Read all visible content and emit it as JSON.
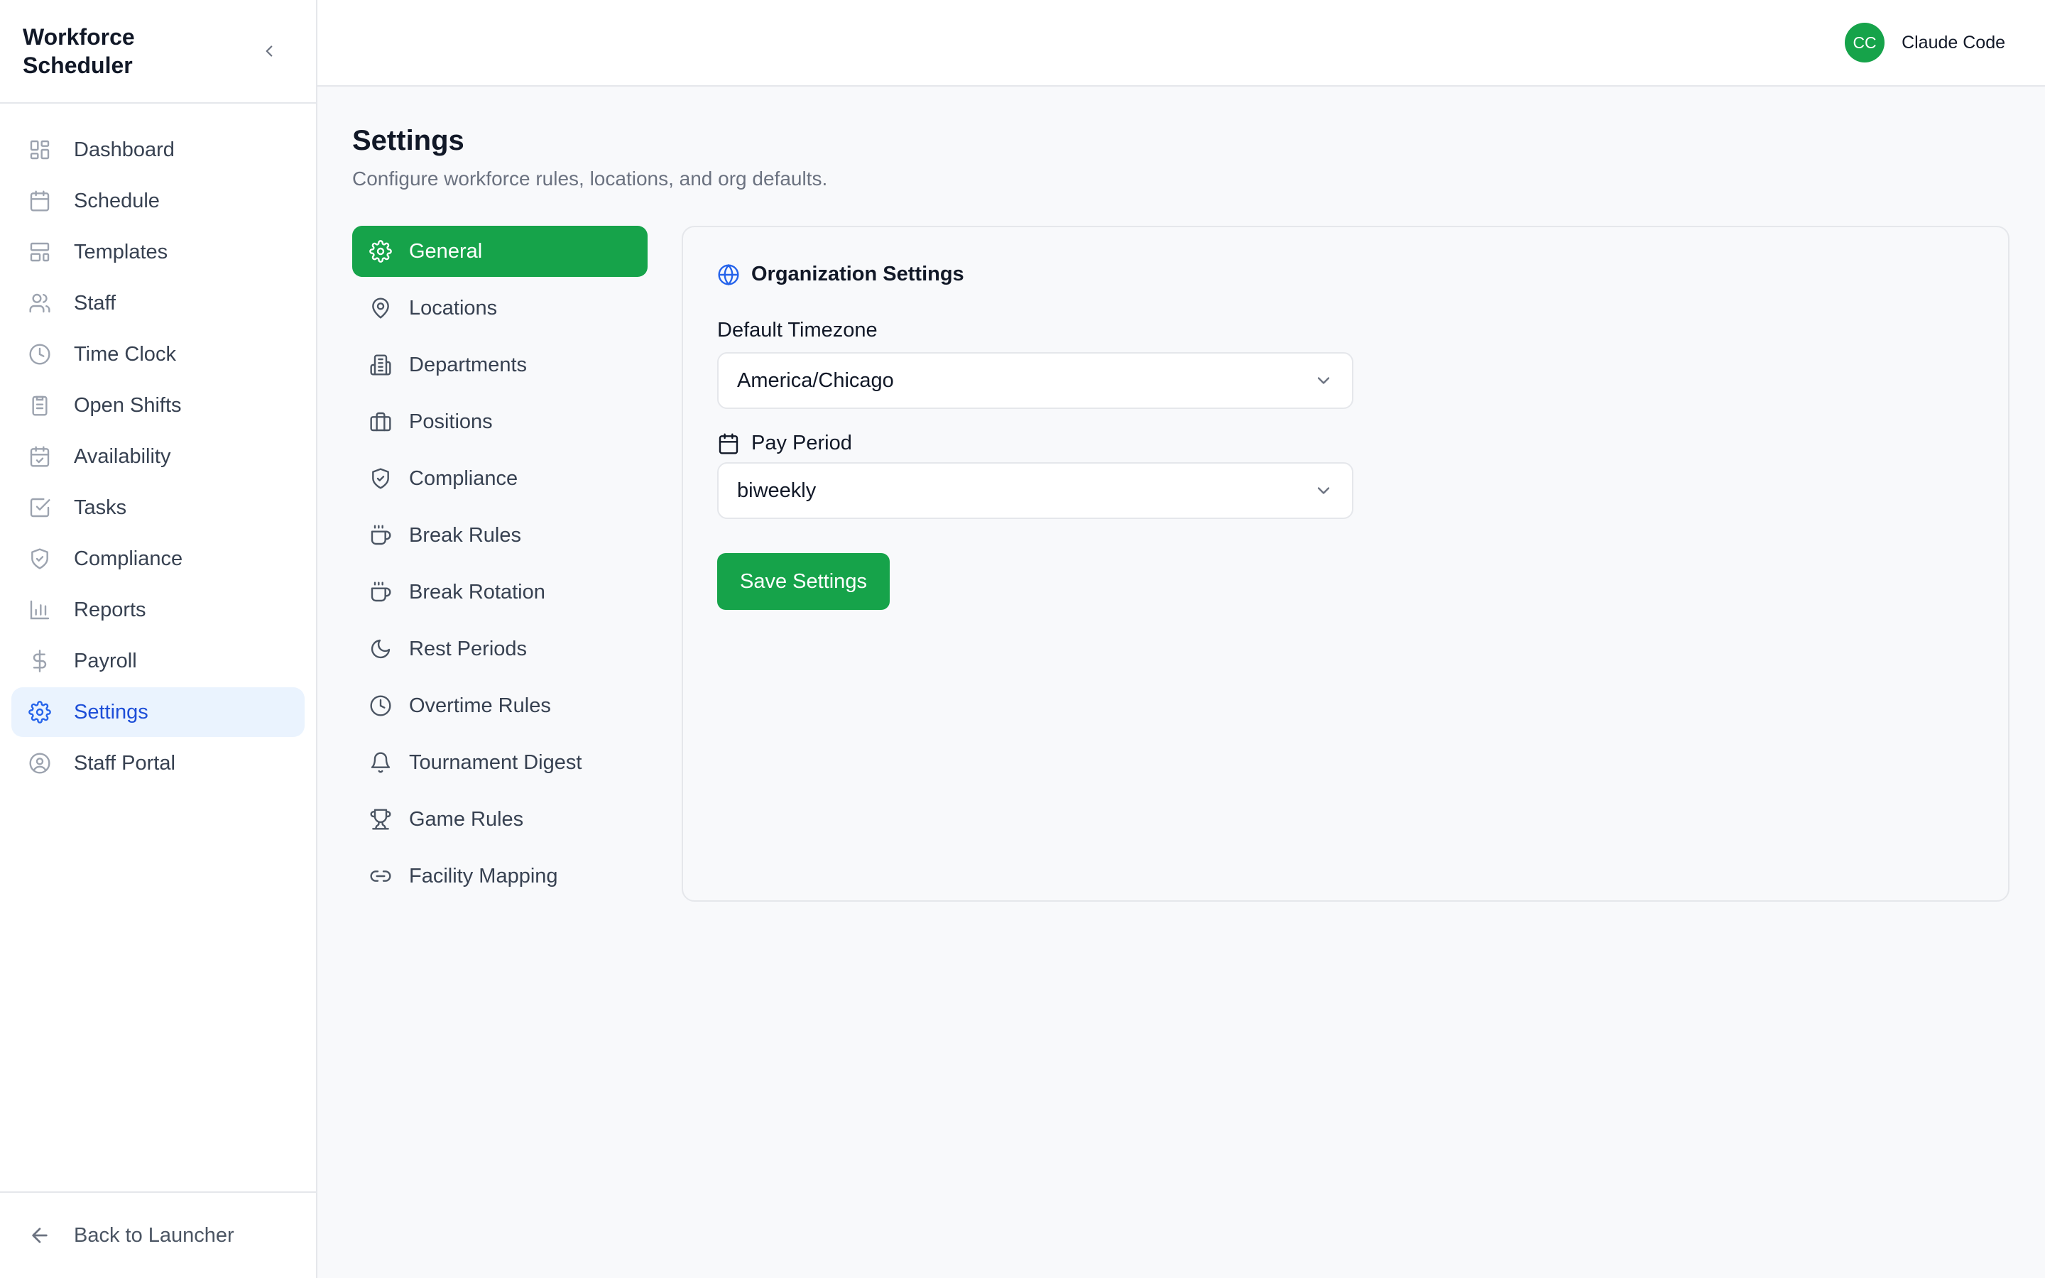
{
  "app": {
    "title": "Workforce Scheduler"
  },
  "sidebar": {
    "items": [
      {
        "label": "Dashboard",
        "icon": "dashboard-icon"
      },
      {
        "label": "Schedule",
        "icon": "calendar-icon"
      },
      {
        "label": "Templates",
        "icon": "templates-icon"
      },
      {
        "label": "Staff",
        "icon": "users-icon"
      },
      {
        "label": "Time Clock",
        "icon": "clock-icon"
      },
      {
        "label": "Open Shifts",
        "icon": "clipboard-icon"
      },
      {
        "label": "Availability",
        "icon": "calendar-check-icon"
      },
      {
        "label": "Tasks",
        "icon": "checkbox-icon"
      },
      {
        "label": "Compliance",
        "icon": "shield-icon"
      },
      {
        "label": "Reports",
        "icon": "bar-chart-icon"
      },
      {
        "label": "Payroll",
        "icon": "dollar-icon"
      },
      {
        "label": "Settings",
        "icon": "gear-icon",
        "active": true
      },
      {
        "label": "Staff Portal",
        "icon": "user-circle-icon"
      }
    ],
    "back_label": "Back to Launcher"
  },
  "user": {
    "initials": "CC",
    "name": "Claude Code"
  },
  "page": {
    "title": "Settings",
    "subtitle": "Configure workforce rules, locations, and org defaults."
  },
  "settings_nav": {
    "items": [
      {
        "label": "General",
        "icon": "gear-icon",
        "active": true
      },
      {
        "label": "Locations",
        "icon": "map-pin-icon"
      },
      {
        "label": "Departments",
        "icon": "building-icon"
      },
      {
        "label": "Positions",
        "icon": "briefcase-icon"
      },
      {
        "label": "Compliance",
        "icon": "shield-check-icon"
      },
      {
        "label": "Break Rules",
        "icon": "coffee-icon"
      },
      {
        "label": "Break Rotation",
        "icon": "coffee-icon"
      },
      {
        "label": "Rest Periods",
        "icon": "moon-icon"
      },
      {
        "label": "Overtime Rules",
        "icon": "clock-icon"
      },
      {
        "label": "Tournament Digest",
        "icon": "bell-icon"
      },
      {
        "label": "Game Rules",
        "icon": "trophy-icon"
      },
      {
        "label": "Facility Mapping",
        "icon": "link-icon"
      }
    ]
  },
  "org_settings": {
    "heading": "Organization Settings",
    "timezone_label": "Default Timezone",
    "timezone_value": "America/Chicago",
    "pay_period_label": "Pay Period",
    "pay_period_value": "biweekly",
    "save_label": "Save Settings"
  },
  "colors": {
    "brand_green": "#16a34a",
    "active_blue": "#1d4ed8",
    "active_bg": "#eaf3fe"
  }
}
